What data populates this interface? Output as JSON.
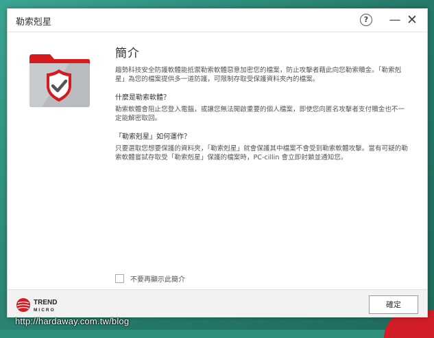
{
  "window": {
    "title": "勒索剋星"
  },
  "controls": {
    "help_glyph": "?",
    "minimize_glyph": "—",
    "close_glyph": "✕"
  },
  "content": {
    "heading": "簡介",
    "intro": "趨勢科技安全防護軟體能抵禦勒索軟體惡意加密您的檔案，防止攻擊者藉此向您勒索贖金。「勒索剋星」為您的檔案提供多一道防護，可限制存取受保護資料夾內的檔案。",
    "q1_title": "什麼是勒索軟體？",
    "q1_body": "勒索軟體會阻止您登入電腦，或讓您無法開啟重要的個人檔案，即使您向匿名攻擊者支付贖金也不一定能解密取回。",
    "q2_title": "「勒索剋星」如何運作？",
    "q2_body": "只要選取您想要保護的資料夾，「勒索剋星」就會保護其中檔案不會受到勒索軟體攻擊。當有可疑的勒索軟體嘗試存取受「勒索剋星」保護的檔案時，PC-cillin 會立即封鎖並通知您。"
  },
  "dont_show": {
    "label": "不要再顯示此簡介",
    "checked": false
  },
  "footer": {
    "brand_top": "TREND",
    "brand_bottom": "MICRO",
    "ok_label": "確定"
  },
  "watermark": "http://hardaway.com.tw/blog",
  "colors": {
    "accent_red": "#d71920",
    "folder_gray": "#b9bcc0",
    "text": "#555555"
  },
  "icons": [
    "help-icon",
    "minimize-icon",
    "close-icon",
    "protected-folder-icon",
    "trend-micro-logo"
  ]
}
